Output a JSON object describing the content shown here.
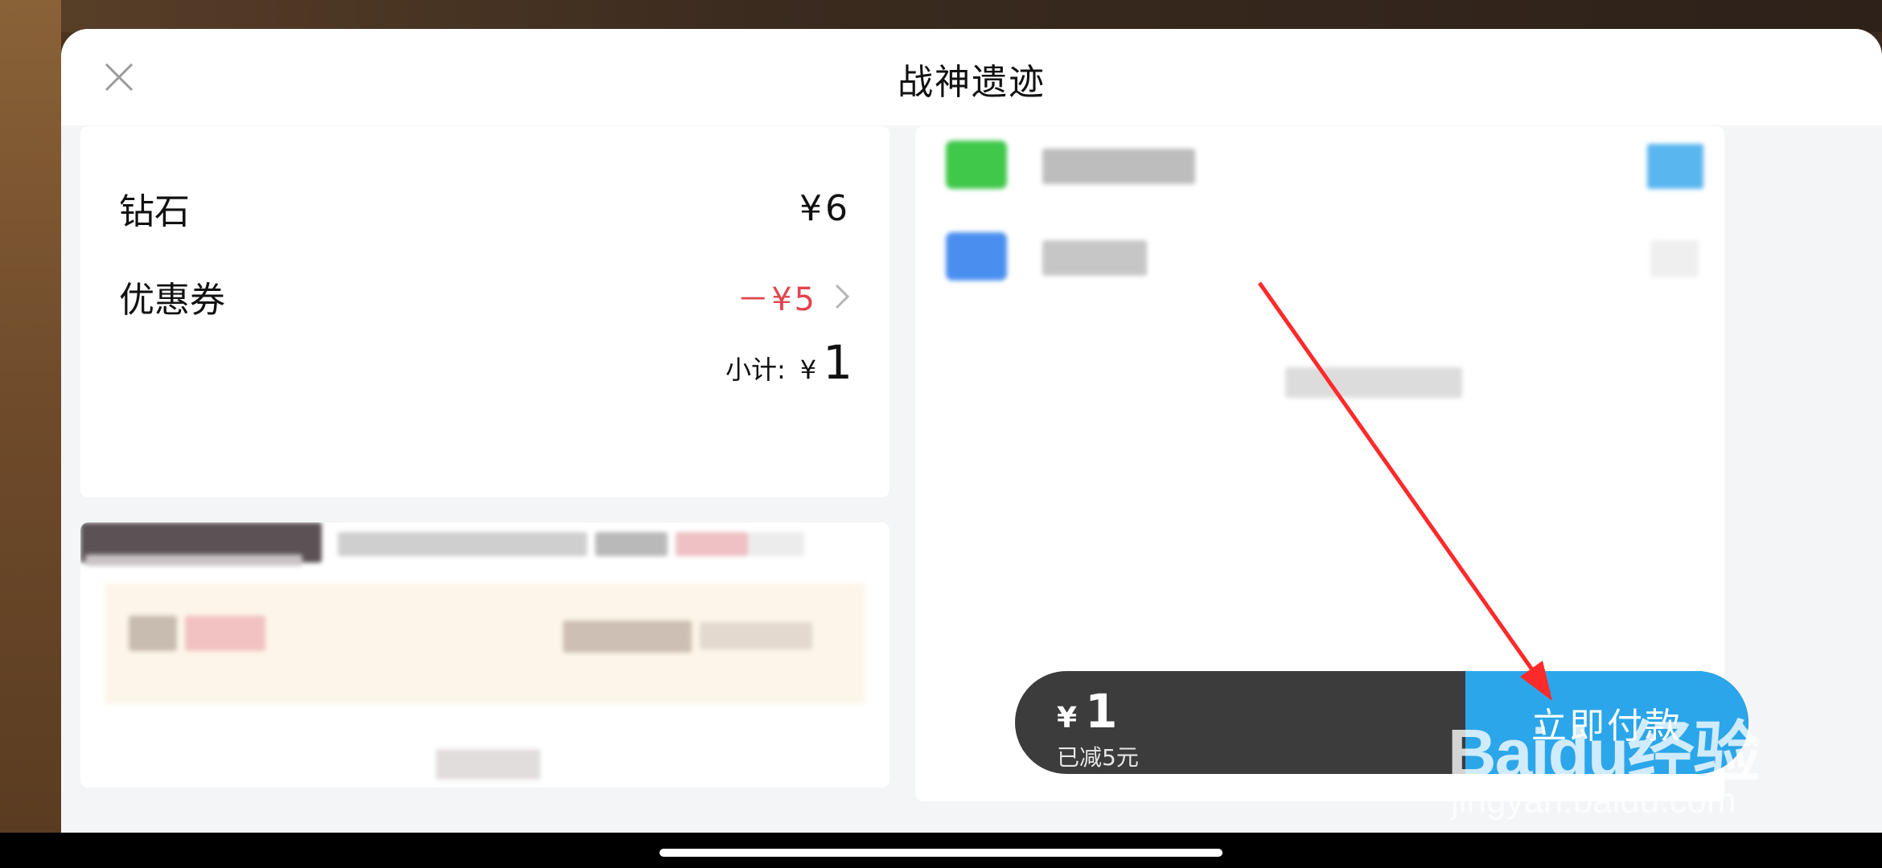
{
  "header": {
    "title": "战神遗迹",
    "close_icon": "close-icon"
  },
  "order": {
    "item_label": "钻石",
    "item_price": "¥6",
    "coupon_label": "优惠券",
    "coupon_value": "－¥5",
    "subtotal_label": "小计:",
    "subtotal_currency": "¥",
    "subtotal_amount": "1"
  },
  "payment": {
    "total_currency": "¥",
    "total_amount": "1",
    "discount_text": "已减5元",
    "pay_button_label": "立即付款",
    "methods": [
      {
        "icon": "wechat-pay-icon",
        "accent": "#3fc84a",
        "selected_color": "#5ab6ef"
      },
      {
        "icon": "alipay-icon",
        "accent": "#4a8ff0"
      }
    ]
  },
  "watermark": {
    "brand": "Baidu经验",
    "url": "jingyan.baidu.com"
  },
  "colors": {
    "accent_blue": "#2ba6ea",
    "coupon_red": "#e2454f",
    "pay_bar_dark": "#3c3c3c"
  }
}
